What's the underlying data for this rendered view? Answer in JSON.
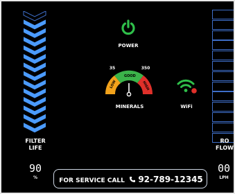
{
  "filter_life": {
    "label_line1": "FILTER",
    "label_line2": "LIFE",
    "value": "90",
    "unit": "%",
    "level_percent": 90
  },
  "power": {
    "label": "POWER",
    "icon": "power-icon",
    "color": "#2fbf4a"
  },
  "minerals": {
    "label": "MINERALS",
    "scale_min": "35",
    "scale_max": "350",
    "zones": [
      "LOW",
      "GOOD",
      "HIGH"
    ],
    "zone_colors": [
      "#f2a21b",
      "#3bb44a",
      "#e0302a"
    ]
  },
  "wifi": {
    "label": "WiFi",
    "icon": "wifi-icon",
    "color": "#2fbf4a",
    "status_color": "#e0302a"
  },
  "ro_flow": {
    "label_line1": "RO",
    "label_line2": "FLOW",
    "value": "00",
    "unit": "LPH",
    "bar_count": 13
  },
  "service": {
    "text": "FOR SERVICE CALL",
    "phone_icon": "phone-icon",
    "phone": "92-789-12345"
  },
  "colors": {
    "background": "#000000",
    "chevron_blue": "#4b9bff",
    "outline_blue": "#3e6ec9"
  }
}
